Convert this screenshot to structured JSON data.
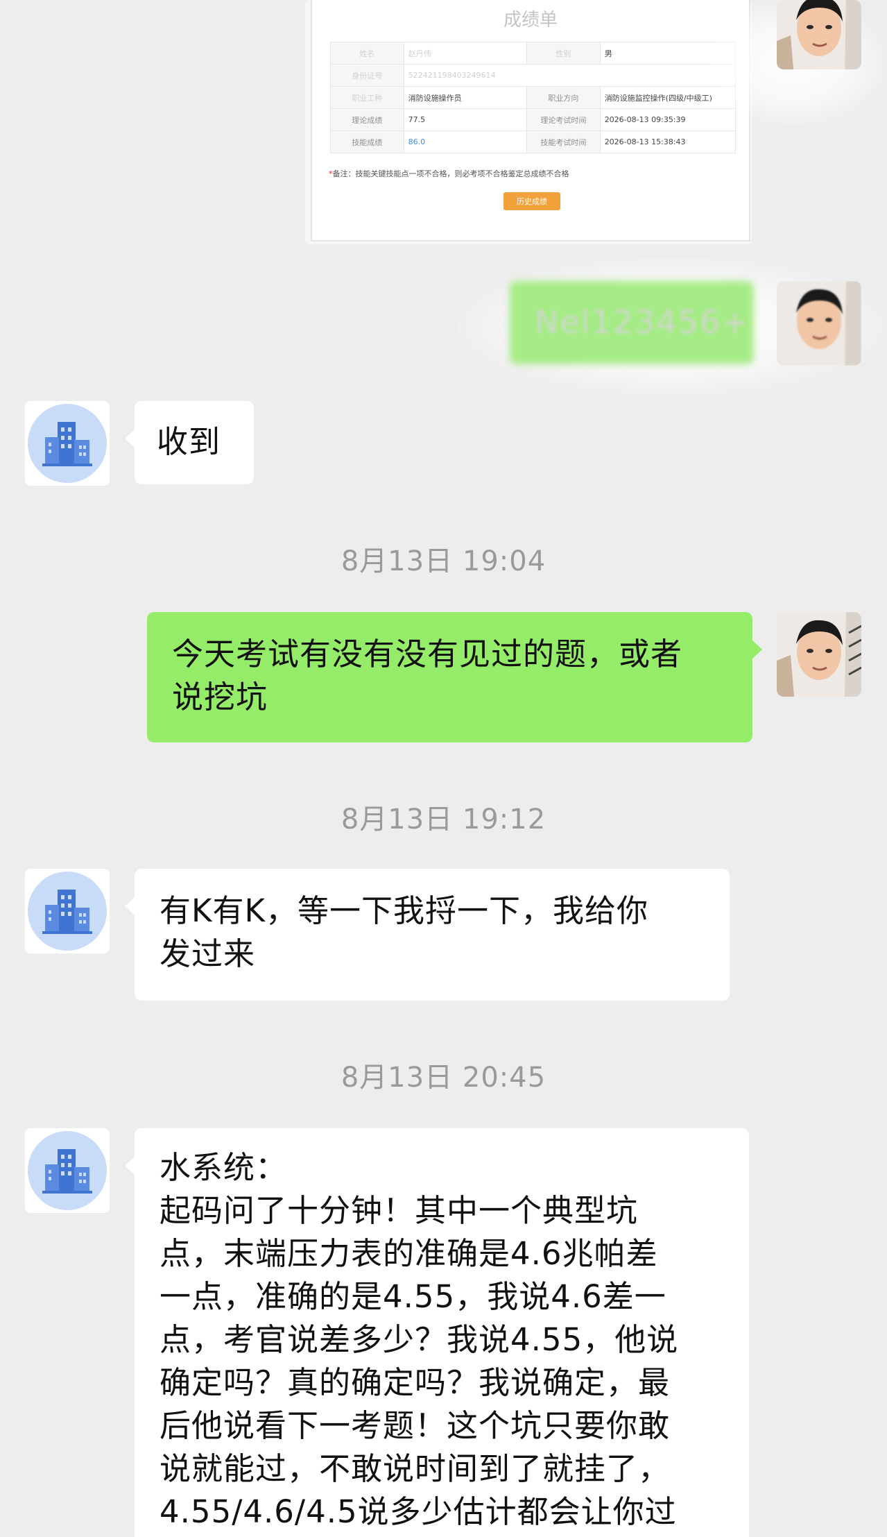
{
  "report_card": {
    "title": "成绩单",
    "rows": [
      {
        "l1": "姓名",
        "v1": "赵丹伟",
        "l2": "性别",
        "v2": "男"
      },
      {
        "l1": "身份证号",
        "v1": "522421198403249614",
        "l2": "",
        "v2": ""
      },
      {
        "l1": "职业工种",
        "v1": "消防设施操作员",
        "l2": "职业方向",
        "v2": "消防设施监控操作(四级/中级工)"
      },
      {
        "l1": "理论成绩",
        "v1": "77.5",
        "l2": "理论考试时间",
        "v2": "2026-08-13 09:35:39"
      },
      {
        "l1": "技能成绩",
        "v1": "86.0",
        "l2": "技能考试时间",
        "v2": "2026-08-13 15:38:43"
      }
    ],
    "note": "备注：技能关键技能点一项不合格，则必考项不合格鉴定总成绩不合格",
    "history_button": "历史成绩",
    "accent_color": "#f2a23a"
  },
  "blurred_message": "Nel123456+",
  "messages": [
    {
      "id": "msg1",
      "side": "left",
      "text": "收到"
    },
    {
      "id": "ts1",
      "type": "timestamp",
      "text": "8月13日 19:04"
    },
    {
      "id": "msg2",
      "side": "right",
      "lines": [
        "今天考试有没有没有见过的题，或者",
        "说挖坑"
      ]
    },
    {
      "id": "ts2",
      "type": "timestamp",
      "text": "8月13日 19:12"
    },
    {
      "id": "msg3",
      "side": "left",
      "lines": [
        "有K有K，等一下我捋一下，我给你",
        "发过来"
      ]
    },
    {
      "id": "ts3",
      "type": "timestamp",
      "text": "8月13日 20:45"
    },
    {
      "id": "msg4",
      "side": "left",
      "lines": [
        "水系统：",
        "起码问了十分钟！其中一个典型坑",
        "点，末端压力表的准确是4.6兆帕差",
        "一点，准确的是4.55，我说4.6差一",
        "点，考官说差多少？我说4.55，他说",
        "确定吗？真的确定吗？我说确定，最",
        "后他说看下一考题！这个坑只要你敢",
        "说就能过，不敢说时间到了就挂了，",
        "4.55/4.6/4.5说多少估计都会让你过"
      ]
    }
  ],
  "colors": {
    "background": "#ededed",
    "self_bubble": "#95ec69",
    "other_bubble": "#ffffff",
    "timestamp": "#9a9a9a"
  },
  "icons": {
    "contact_avatar": "office-building-icon",
    "self_avatar": "user-photo"
  }
}
